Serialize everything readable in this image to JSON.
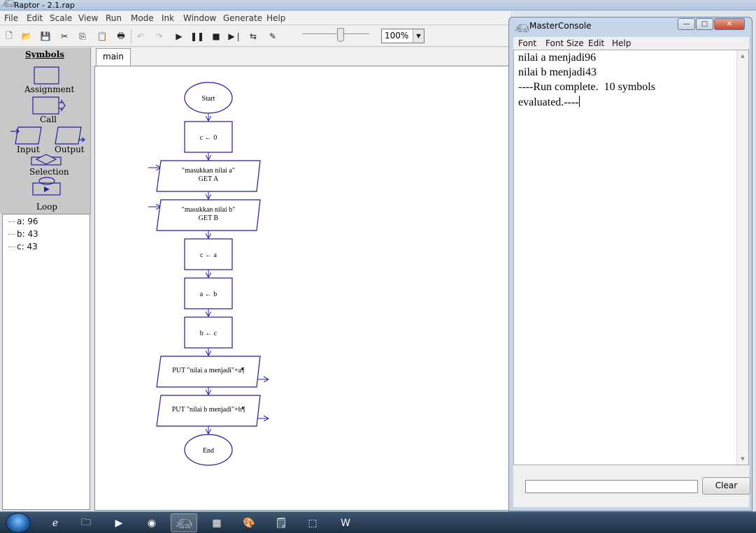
{
  "window": {
    "title": "Raptor - 2.1.rap"
  },
  "menubar": [
    "File",
    "Edit",
    "Scale",
    "View",
    "Run",
    "Mode",
    "Ink",
    "Window",
    "Generate",
    "Help"
  ],
  "toolbar": {
    "buttons": [
      "new-file",
      "open-folder",
      "save",
      "cut",
      "copy",
      "paste",
      "print",
      "undo",
      "redo",
      "play",
      "pause",
      "stop",
      "step",
      "test-server",
      "pen"
    ],
    "zoom": "100%",
    "speed_level_percent": 58
  },
  "palette": {
    "heading": "Symbols",
    "symbols": {
      "assignment": "Assignment",
      "call": "Call",
      "input": "Input",
      "output": "Output",
      "selection": "Selection",
      "loop": "Loop"
    }
  },
  "variables": [
    "a: 96",
    "b: 43",
    "c: 43"
  ],
  "tabs": [
    "main"
  ],
  "flowchart": {
    "start": "Start",
    "assign_c0": "c ← 0",
    "input_a_prompt": "\"masukkan nilai a\"",
    "input_a_get": "GET A",
    "input_b_prompt": "\"masukkan nilai b\"",
    "input_b_get": "GET B",
    "assign_ca": "c ← a",
    "assign_ab": "a ← b",
    "assign_bc": "b ← c",
    "output_a": "PUT \"nilai a menjadi\"+a¶",
    "output_b": "PUT \"nilai b menjadi\"+b¶",
    "end": "End"
  },
  "console": {
    "title": "MasterConsole",
    "menu": [
      "Font",
      "Font Size",
      "Edit",
      "Help"
    ],
    "lines": [
      "nilai a menjadi96",
      "nilai b menjadi43",
      "----Run complete.  10 symbols",
      "evaluated.----"
    ],
    "input_value": "",
    "clear_label": "Clear"
  },
  "taskbar": {
    "apps": [
      "internet-explorer",
      "file-explorer",
      "media-player",
      "chrome",
      "raptor",
      "dev-cpp",
      "paint",
      "notepad",
      "acrobat-reader",
      "word"
    ]
  }
}
